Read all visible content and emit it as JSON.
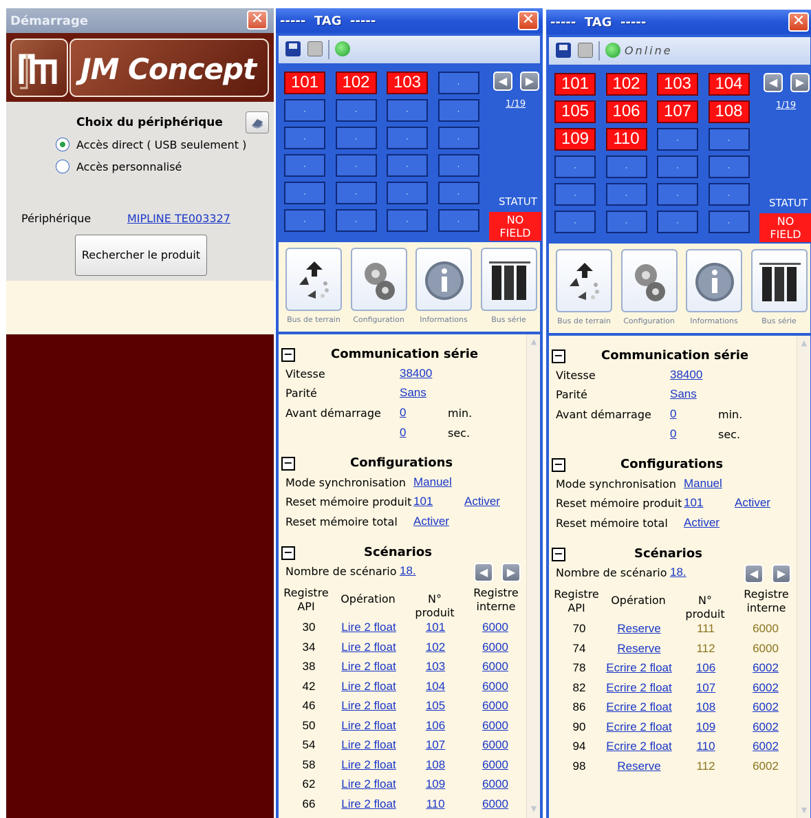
{
  "start_window": {
    "title": "Démarrage",
    "close_glyph": "✕",
    "brand": "JM Concept",
    "heading": "Choix du périphérique",
    "radios": [
      {
        "label": "Accès direct ( USB seulement )",
        "checked": true
      },
      {
        "label": "Accès personnalisé",
        "checked": false
      }
    ],
    "device_label": "Périphérique",
    "device_value": "MIPLINE TE003327",
    "search_button": "Rechercher le produit"
  },
  "tag_windows": [
    {
      "title": "-----  TAG  -----",
      "toolbar_status": "",
      "tiles": [
        "101",
        "102",
        "103",
        "",
        "",
        "",
        "",
        "",
        "",
        "",
        "",
        "",
        "",
        "",
        "",
        "",
        "",
        "",
        "",
        "",
        "",
        "",
        "",
        ""
      ],
      "active_count": 3,
      "page": "1/19",
      "statut_label": "STATUT",
      "statut_value": "NO\nFIELD",
      "icon_captions": [
        "Bus de terrain",
        "Configuration",
        "Informations",
        "Bus série"
      ],
      "comm": {
        "title": "Communication série",
        "vitesse_label": "Vitesse",
        "vitesse": "38400",
        "parite_label": "Parité",
        "parite": "Sans",
        "avant_label": "Avant démarrage",
        "min_value": "0",
        "min_unit": "min.",
        "sec_value": "0",
        "sec_unit": "sec."
      },
      "config": {
        "title": "Configurations",
        "mode_label": "Mode synchronisation",
        "mode_value": "Manuel",
        "reset_prod_label": "Reset mémoire produit",
        "reset_prod_value": "101",
        "reset_prod_action": "Activer",
        "reset_total_label": "Reset mémoire total",
        "reset_total_action": "Activer"
      },
      "scen": {
        "title": "Scénarios",
        "count_label": "Nombre de scénario",
        "count_value": "18.",
        "headers": [
          "Registre\nAPI",
          "Opération",
          "N° produit",
          "Registre\ninterne"
        ],
        "rows": [
          {
            "api": "30",
            "op": "Lire 2 float",
            "prod": "101",
            "reg": "6000",
            "link": true
          },
          {
            "api": "34",
            "op": "Lire 2 float",
            "prod": "102",
            "reg": "6000",
            "link": true
          },
          {
            "api": "38",
            "op": "Lire 2 float",
            "prod": "103",
            "reg": "6000",
            "link": true
          },
          {
            "api": "42",
            "op": "Lire 2 float",
            "prod": "104",
            "reg": "6000",
            "link": true
          },
          {
            "api": "46",
            "op": "Lire 2 float",
            "prod": "105",
            "reg": "6000",
            "link": true
          },
          {
            "api": "50",
            "op": "Lire 2 float",
            "prod": "106",
            "reg": "6000",
            "link": true
          },
          {
            "api": "54",
            "op": "Lire 2 float",
            "prod": "107",
            "reg": "6000",
            "link": true
          },
          {
            "api": "58",
            "op": "Lire 2 float",
            "prod": "108",
            "reg": "6000",
            "link": true
          },
          {
            "api": "62",
            "op": "Lire 2 float",
            "prod": "109",
            "reg": "6000",
            "link": true
          },
          {
            "api": "66",
            "op": "Lire 2 float",
            "prod": "110",
            "reg": "6000",
            "link": true
          }
        ]
      }
    },
    {
      "title": "-----  TAG  -----",
      "toolbar_status": "Online",
      "tiles": [
        "101",
        "102",
        "103",
        "104",
        "105",
        "106",
        "107",
        "108",
        "109",
        "110",
        "",
        "",
        "",
        "",
        "",
        "",
        "",
        "",
        "",
        "",
        "",
        "",
        "",
        ""
      ],
      "active_count": 10,
      "page": "1/19",
      "statut_label": "STATUT",
      "statut_value": "NO\nFIELD",
      "icon_captions": [
        "Bus de terrain",
        "Configuration",
        "Informations",
        "Bus série"
      ],
      "comm": {
        "title": "Communication série",
        "vitesse_label": "Vitesse",
        "vitesse": "38400",
        "parite_label": "Parité",
        "parite": "Sans",
        "avant_label": "Avant démarrage",
        "min_value": "0",
        "min_unit": "min.",
        "sec_value": "0",
        "sec_unit": "sec."
      },
      "config": {
        "title": "Configurations",
        "mode_label": "Mode synchronisation",
        "mode_value": "Manuel",
        "reset_prod_label": "Reset mémoire produit",
        "reset_prod_value": "101",
        "reset_prod_action": "Activer",
        "reset_total_label": "Reset mémoire total",
        "reset_total_action": "Activer"
      },
      "scen": {
        "title": "Scénarios",
        "count_label": "Nombre de scénario",
        "count_value": "18.",
        "headers": [
          "Registre\nAPI",
          "Opération",
          "N° produit",
          "Registre\ninterne"
        ],
        "rows": [
          {
            "api": "70",
            "op": "Reserve",
            "prod": "111",
            "reg": "6000",
            "link": false
          },
          {
            "api": "74",
            "op": "Reserve",
            "prod": "112",
            "reg": "6000",
            "link": false
          },
          {
            "api": "78",
            "op": "Ecrire 2 float",
            "prod": "106",
            "reg": "6002",
            "link": true
          },
          {
            "api": "82",
            "op": "Ecrire 2 float",
            "prod": "107",
            "reg": "6002",
            "link": true
          },
          {
            "api": "86",
            "op": "Ecrire 2 float",
            "prod": "108",
            "reg": "6002",
            "link": true
          },
          {
            "api": "90",
            "op": "Ecrire 2 float",
            "prod": "109",
            "reg": "6002",
            "link": true
          },
          {
            "api": "94",
            "op": "Ecrire 2 float",
            "prod": "110",
            "reg": "6002",
            "link": true
          },
          {
            "api": "98",
            "op": "Reserve",
            "prod": "112",
            "reg": "6002",
            "link": false
          }
        ]
      }
    }
  ],
  "colors": {
    "active_tile": "#ff1010",
    "idle_tile": "#3a6bdf",
    "link": "#1a36c8",
    "reserved_value": "#8a7420"
  },
  "icons": [
    "close-icon",
    "save-icon",
    "print-icon",
    "refresh-icon",
    "prev-arrow-icon",
    "next-arrow-icon",
    "fieldbus-icon",
    "configuration-gears-icon",
    "information-icon",
    "serial-bus-icon",
    "collapse-icon"
  ]
}
